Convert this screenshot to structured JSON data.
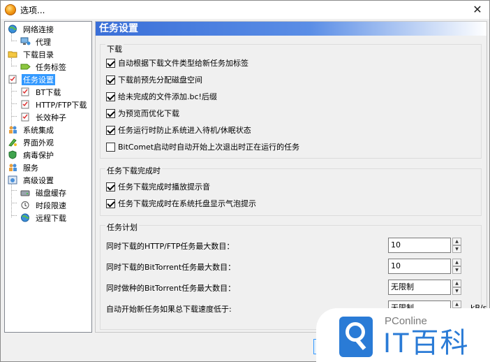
{
  "window": {
    "title": "选项..."
  },
  "tree": {
    "items": [
      {
        "label": "网络连接",
        "level": 0,
        "icon": "globe-network-icon"
      },
      {
        "label": "代理",
        "level": 1,
        "icon": "proxy-computer-icon"
      },
      {
        "label": "下载目录",
        "level": 0,
        "icon": "folder-icon"
      },
      {
        "label": "任务标签",
        "level": 1,
        "icon": "tag-icon"
      },
      {
        "label": "任务设置",
        "level": 0,
        "icon": "task-settings-icon",
        "selected": true
      },
      {
        "label": "BT下载",
        "level": 1,
        "icon": "bt-task-icon"
      },
      {
        "label": "HTTP/FTP下载",
        "level": 1,
        "icon": "http-task-icon"
      },
      {
        "label": "长效种子",
        "level": 1,
        "icon": "seed-task-icon"
      },
      {
        "label": "系统集成",
        "level": 0,
        "icon": "users-icon"
      },
      {
        "label": "界面外观",
        "level": 0,
        "icon": "appearance-icon"
      },
      {
        "label": "病毒保护",
        "level": 0,
        "icon": "shield-icon"
      },
      {
        "label": "服务",
        "level": 0,
        "icon": "service-users-icon"
      },
      {
        "label": "高级设置",
        "level": 0,
        "icon": "advanced-settings-icon"
      },
      {
        "label": "磁盘缓存",
        "level": 1,
        "icon": "disk-cache-icon"
      },
      {
        "label": "时段限速",
        "level": 1,
        "icon": "time-limit-icon"
      },
      {
        "label": "远程下载",
        "level": 1,
        "icon": "remote-download-icon"
      }
    ]
  },
  "panel": {
    "header": "任务设置",
    "download_group": {
      "title": "下载",
      "options": [
        {
          "label": "自动根据下载文件类型给新任务加标签",
          "checked": true
        },
        {
          "label": "下载前预先分配磁盘空间",
          "checked": true
        },
        {
          "label": "给未完成的文件添加.bc!后缀",
          "checked": true
        },
        {
          "label": "为预览而优化下载",
          "checked": true
        },
        {
          "label": "任务运行时防止系统进入待机/休眠状态",
          "checked": true
        },
        {
          "label": "BitComet启动时自动开始上次退出时正在运行的任务",
          "checked": false
        }
      ]
    },
    "complete_group": {
      "title": "任务下载完成时",
      "options": [
        {
          "label": "任务下载完成时播放提示音",
          "checked": true
        },
        {
          "label": "任务下载完成时在系统托盘显示气泡提示",
          "checked": true
        }
      ]
    },
    "schedule_group": {
      "title": "任务计划",
      "rows": [
        {
          "label": "同时下载的HTTP/FTP任务最大数目：",
          "value": "10",
          "unit": ""
        },
        {
          "label": "同时下载的BitTorrent任务最大数目：",
          "value": "10",
          "unit": ""
        },
        {
          "label": "同时做种的BitTorrent任务最大数目：",
          "value": "无限制",
          "unit": ""
        },
        {
          "label": "自动开始新任务如果总下载速度低于:",
          "value": "无限制",
          "unit": "kB/s"
        }
      ]
    }
  },
  "watermark": {
    "small": "PConline",
    "big": "IT百科"
  }
}
